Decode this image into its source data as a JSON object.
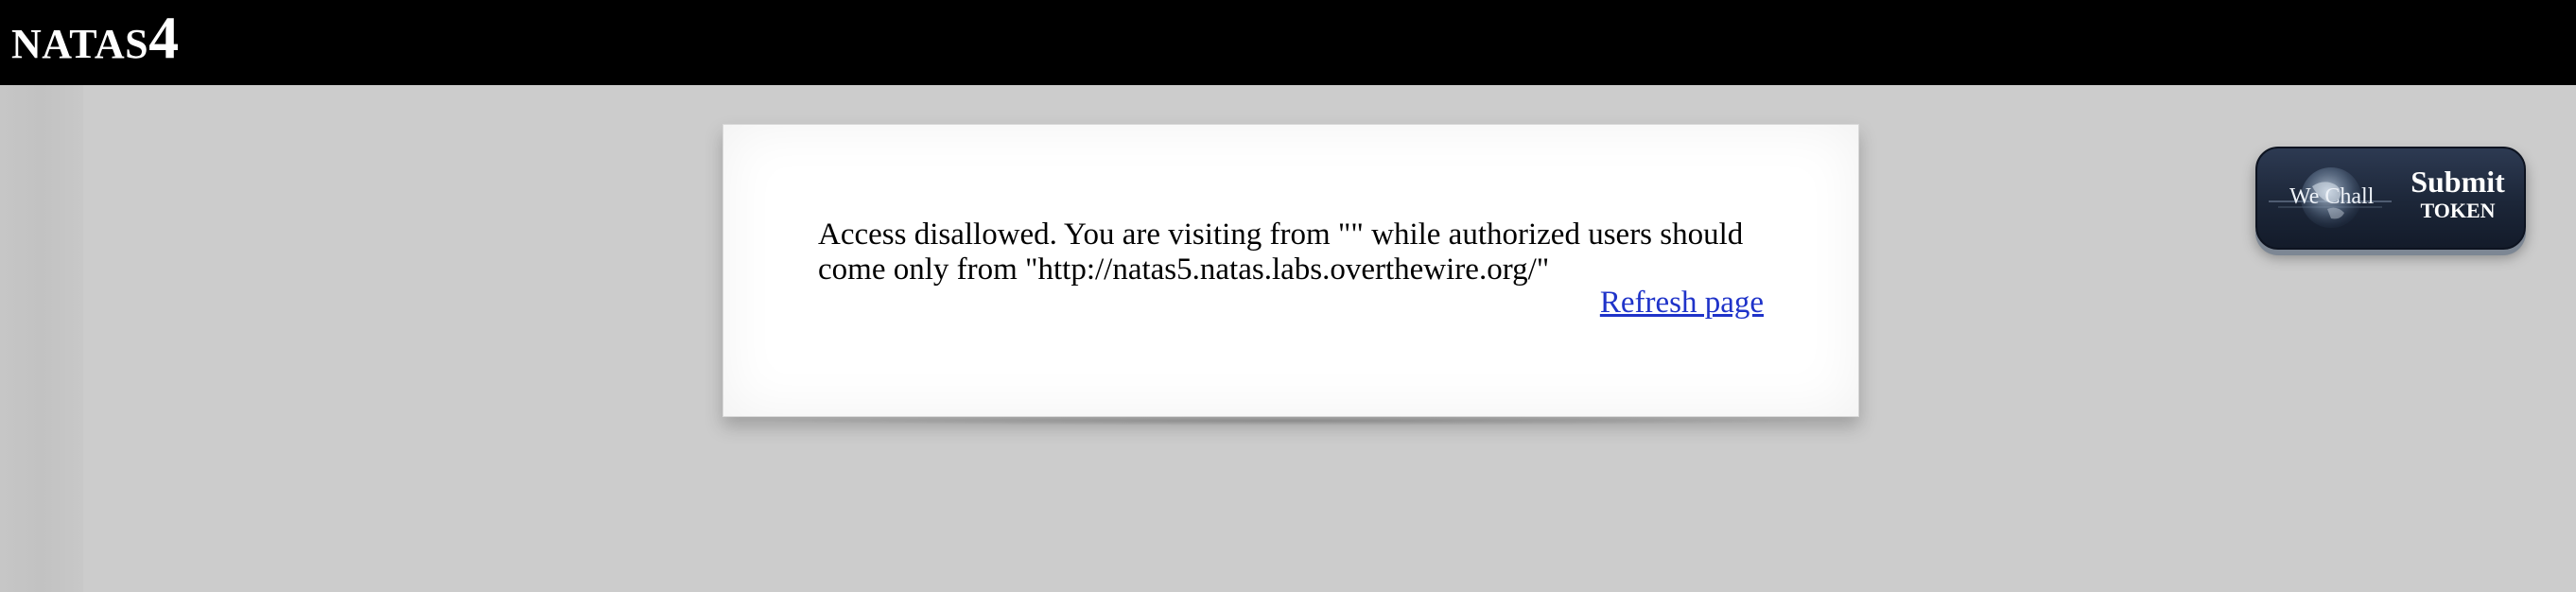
{
  "header": {
    "title_prefix": "NATAS",
    "title_number": "4"
  },
  "main": {
    "message": "Access disallowed. You are visiting from \"\" while authorized users should come only from \"http://natas5.natas.labs.overthewire.org/\"",
    "refresh_label": "Refresh page"
  },
  "submit": {
    "brand": "We Chall",
    "line1": "Submit",
    "line2": "TOKEN"
  },
  "colors": {
    "header_bg": "#000000",
    "page_bg": "#cccccc",
    "link": "#1f33c9",
    "button_bg": "#1c2638"
  },
  "icons": {
    "globe": "globe-icon"
  }
}
